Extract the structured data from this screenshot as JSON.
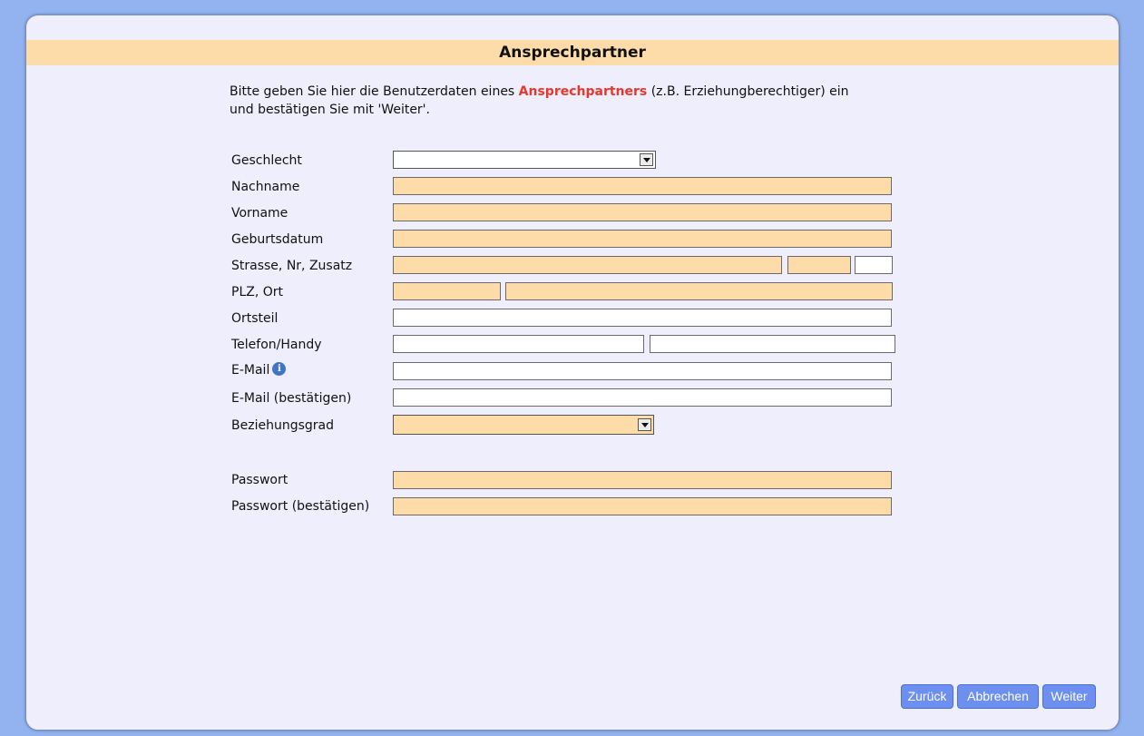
{
  "page": {
    "title": "Ansprechpartner"
  },
  "intro": {
    "line1_before": "Bitte geben Sie hier die Benutzerdaten eines ",
    "line1_highlight": "Ansprechpartners",
    "line1_after": " (z.B. Erziehungberechtiger) ein",
    "line2": "und bestätigen Sie mit 'Weiter'."
  },
  "form": {
    "labels": {
      "gender": "Geschlecht",
      "lastname": "Nachname",
      "firstname": "Vorname",
      "birthdate": "Geburtsdatum",
      "street": "Strasse, Nr, Zusatz",
      "zip_city": "PLZ, Ort",
      "district": "Ortsteil",
      "phone": "Telefon/Handy",
      "email": "E-Mail",
      "email_confirm": "E-Mail (bestätigen)",
      "relation": "Beziehungsgrad",
      "password": "Passwort",
      "password_confirm": "Passwort (bestätigen)"
    },
    "values": {
      "gender": "",
      "lastname": "",
      "firstname": "",
      "birthdate": "",
      "street": "",
      "house_no": "",
      "addition": "",
      "zip": "",
      "city": "",
      "district": "",
      "phone": "",
      "mobile": "",
      "email": "",
      "email_confirm": "",
      "relation": "",
      "password": "",
      "password_confirm": ""
    },
    "email_info_icon": "i"
  },
  "buttons": {
    "back": "Zurück",
    "cancel": "Abbrechen",
    "next": "Weiter"
  },
  "colors": {
    "required_field": "#fddcaa",
    "highlight": "#e8372b",
    "button": "#6c8ff0"
  }
}
